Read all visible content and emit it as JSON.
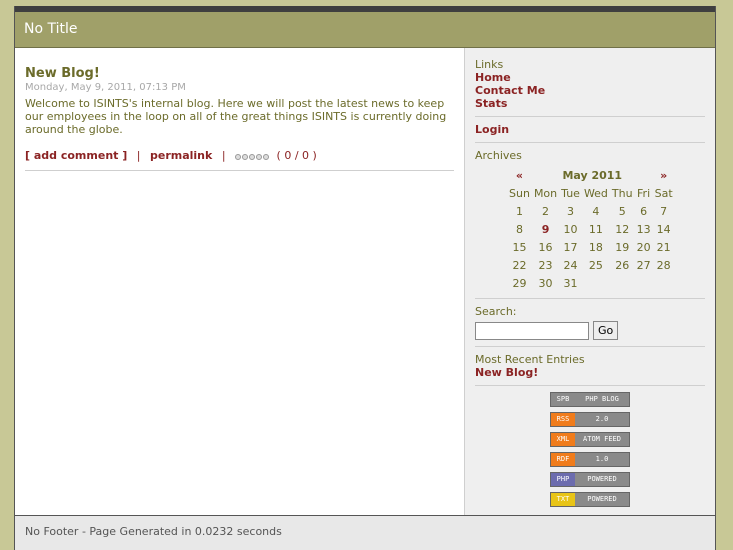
{
  "header": {
    "title": "No Title"
  },
  "post": {
    "title": "New Blog!",
    "date": "Monday, May 9, 2011, 07:13 PM",
    "body": "Welcome to ISINTS's internal blog. Here we will post the latest news to keep our employees in the loop on all of the great things ISINTS is currently doing around the globe.",
    "add_comment": "[ add comment ]",
    "separator": "|",
    "permalink": "permalink",
    "rating": "( 0 / 0 )"
  },
  "sidebar": {
    "links_label": "Links",
    "links": [
      "Home",
      "Contact Me",
      "Stats"
    ],
    "login": "Login",
    "archives_label": "Archives",
    "calendar": {
      "prev": "«",
      "month": "May 2011",
      "next": "»",
      "days": [
        "Sun",
        "Mon",
        "Tue",
        "Wed",
        "Thu",
        "Fri",
        "Sat"
      ],
      "weeks": [
        [
          "1",
          "2",
          "3",
          "4",
          "5",
          "6",
          "7"
        ],
        [
          "8",
          "9",
          "10",
          "11",
          "12",
          "13",
          "14"
        ],
        [
          "15",
          "16",
          "17",
          "18",
          "19",
          "20",
          "21"
        ],
        [
          "22",
          "23",
          "24",
          "25",
          "26",
          "27",
          "28"
        ],
        [
          "29",
          "30",
          "31",
          "",
          "",
          "",
          ""
        ]
      ],
      "highlight": "9"
    },
    "search_label": "Search:",
    "go_label": "Go",
    "recent_label": "Most Recent Entries",
    "recent": [
      "New Blog!"
    ],
    "badges": [
      {
        "left": "SPB",
        "right": "PHP BLOG",
        "color": "#8a8a8a"
      },
      {
        "left": "RSS",
        "right": "2.0",
        "color": "#f07c1c"
      },
      {
        "left": "XML",
        "right": "ATOM FEED",
        "color": "#f07c1c"
      },
      {
        "left": "RDF",
        "right": "1.0",
        "color": "#f07c1c"
      },
      {
        "left": "PHP",
        "right": "POWERED",
        "color": "#6c6cae"
      },
      {
        "left": "TXT",
        "right": "POWERED",
        "color": "#e8c417"
      }
    ]
  },
  "footer": {
    "text": "No Footer - Page Generated in 0.0232 seconds"
  }
}
